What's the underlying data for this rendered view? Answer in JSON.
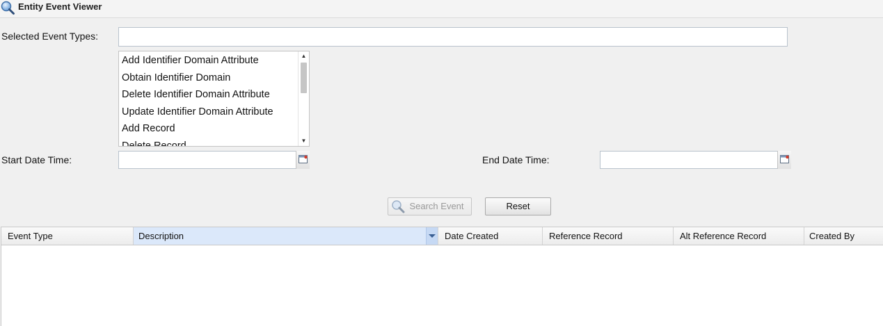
{
  "window": {
    "title": "Entity Event Viewer",
    "icon": "magnifier-icon"
  },
  "form": {
    "selected_event_types_label": "Selected Event Types:",
    "selected_event_types_value": "",
    "event_type_options": [
      "Add Identifier Domain Attribute",
      "Obtain Identifier Domain",
      "Delete Identifier Domain Attribute",
      "Update Identifier Domain Attribute",
      "Add Record",
      "Delete Record"
    ],
    "start_date_label": "Start Date Time:",
    "start_date_value": "",
    "end_date_label": "End Date Time:",
    "end_date_value": ""
  },
  "buttons": {
    "search_label": "Search Event",
    "reset_label": "Reset"
  },
  "grid": {
    "columns": [
      "Event Type",
      "Description",
      "Date Created",
      "Reference Record",
      "Alt Reference Record",
      "Created By"
    ],
    "sorted_column": "Description",
    "rows": []
  },
  "colors": {
    "background": "#f0f0f0",
    "header_active": "#dbe8fa",
    "accent": "#3a5f93"
  }
}
